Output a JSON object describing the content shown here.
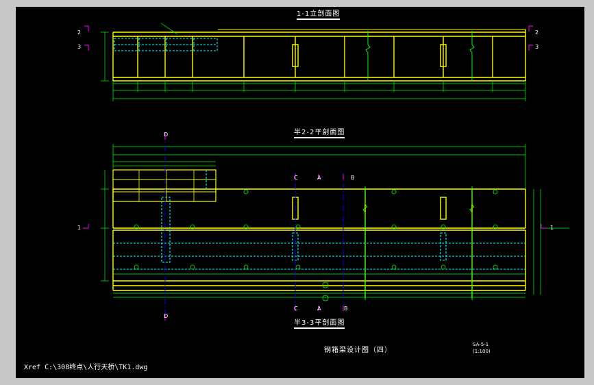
{
  "titles": {
    "section_1": "1-1立剖面图",
    "section_2": "半2-2平剖面图",
    "section_3": "半3-3平剖面图",
    "drawing_title": "钢箱梁设计图（四）",
    "drawing_no": "SA-5-1",
    "scale": "(1:100)"
  },
  "xref": "Xref C:\\308终点\\人行天桥\\TK1.dwg",
  "markers": {
    "s2": "2",
    "s3": "3",
    "s1": "1",
    "D": "D",
    "C": "C",
    "A": "A",
    "B": "B"
  },
  "colors": {
    "steel": "#ffff00",
    "dim": "#00ff00",
    "hidden": "#00ffff",
    "axis": "#0000ff",
    "marker": "#ff00ff",
    "text": "#ffffff"
  }
}
